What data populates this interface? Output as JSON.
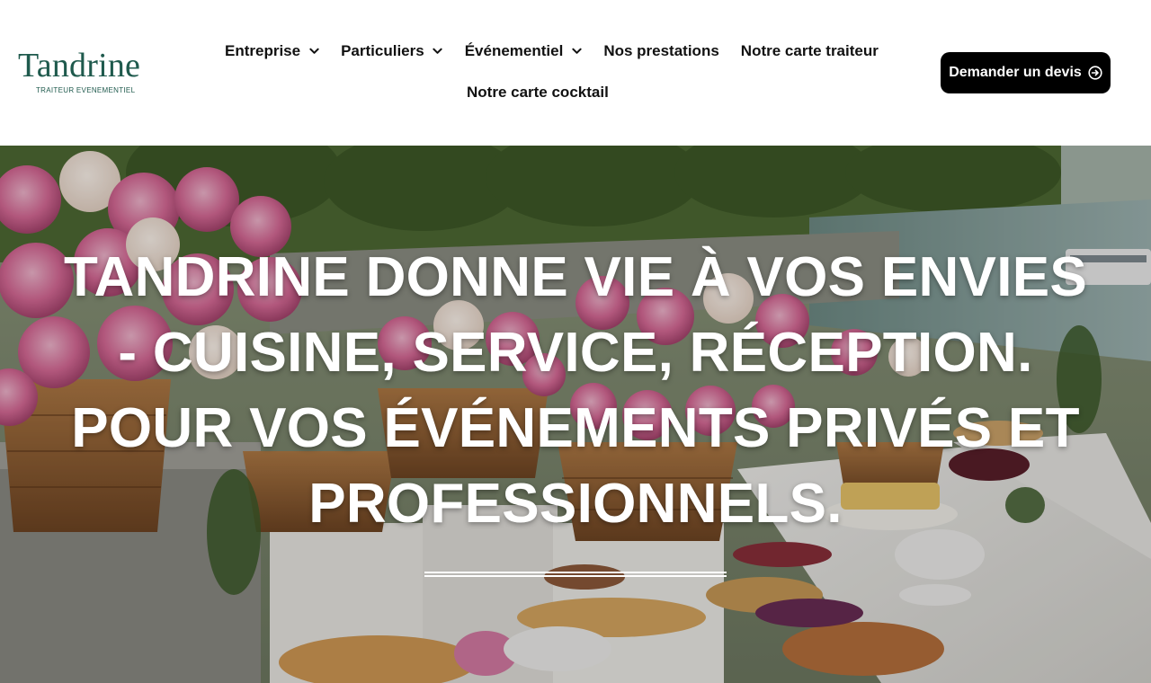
{
  "brand": {
    "name": "Tandrine",
    "tagline": "TRAITEUR EVENEMENTIEL",
    "color": "#1f5a4d"
  },
  "nav": {
    "row1": [
      {
        "label": "Entreprise",
        "has_dropdown": true
      },
      {
        "label": "Particuliers",
        "has_dropdown": true
      },
      {
        "label": "Événementiel",
        "has_dropdown": true
      },
      {
        "label": "Nos prestations",
        "has_dropdown": false
      },
      {
        "label": "Notre carte traiteur",
        "has_dropdown": false
      }
    ],
    "row2": [
      {
        "label": "Notre carte cocktail",
        "has_dropdown": false
      }
    ],
    "dropdown_icon": "chevron-down-icon"
  },
  "cta": {
    "label": "Demander un devis",
    "icon": "arrow-circle-right-icon",
    "background": "#000000"
  },
  "hero": {
    "lines": [
      "TANDRINE DONNE VIE À VOS ENVIES",
      "- CUISINE, SERVICE, RÉCEPTION.",
      "POUR VOS ÉVÉNEMENTS PRIVÉS ET",
      "PROFESSIONNELS."
    ],
    "image": "Buffet traiteur avec paniers de pivoines roses au bord de la Seine"
  }
}
